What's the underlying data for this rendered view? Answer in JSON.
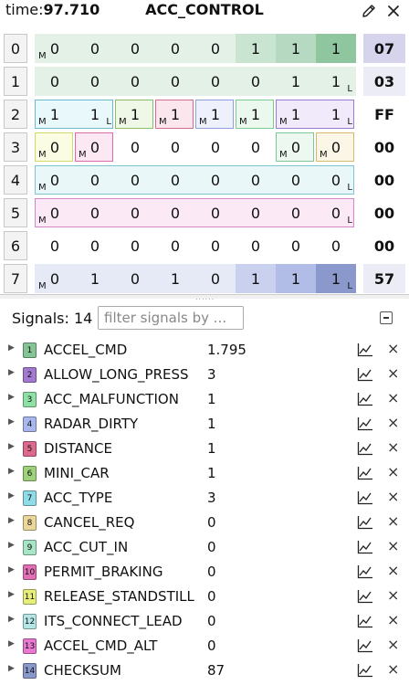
{
  "header": {
    "time_label": "time:",
    "time_value": "97.710",
    "title": "ACC_CONTROL"
  },
  "bytes": [
    {
      "index": "0",
      "bits": [
        "0",
        "0",
        "0",
        "0",
        "0",
        "1",
        "1",
        "1"
      ],
      "hex": "07"
    },
    {
      "index": "1",
      "bits": [
        "0",
        "0",
        "0",
        "0",
        "0",
        "0",
        "1",
        "1"
      ],
      "hex": "03"
    },
    {
      "index": "2",
      "bits": [
        "1",
        "1",
        "1",
        "1",
        "1",
        "1",
        "1",
        "1"
      ],
      "hex": "FF"
    },
    {
      "index": "3",
      "bits": [
        "0",
        "0",
        "0",
        "0",
        "0",
        "0",
        "0",
        "0"
      ],
      "hex": "00"
    },
    {
      "index": "4",
      "bits": [
        "0",
        "0",
        "0",
        "0",
        "0",
        "0",
        "0",
        "0"
      ],
      "hex": "00"
    },
    {
      "index": "5",
      "bits": [
        "0",
        "0",
        "0",
        "0",
        "0",
        "0",
        "0",
        "0"
      ],
      "hex": "00"
    },
    {
      "index": "6",
      "bits": [
        "0",
        "0",
        "0",
        "0",
        "0",
        "0",
        "0",
        "0"
      ],
      "hex": "00"
    },
    {
      "index": "7",
      "bits": [
        "0",
        "1",
        "0",
        "1",
        "0",
        "1",
        "1",
        "1"
      ],
      "hex": "57"
    }
  ],
  "marker_msb": "M",
  "marker_lsb": "L",
  "signals_header": {
    "label": "Signals: 14",
    "filter_placeholder": "filter signals by ..."
  },
  "signals": [
    {
      "num": "1",
      "name": "ACCEL_CMD",
      "value": "1.795",
      "color": "#86c496"
    },
    {
      "num": "2",
      "name": "ALLOW_LONG_PRESS",
      "value": "3",
      "color": "#a27ad0"
    },
    {
      "num": "3",
      "name": "ACC_MALFUNCTION",
      "value": "1",
      "color": "#8fe0a4"
    },
    {
      "num": "4",
      "name": "RADAR_DIRTY",
      "value": "1",
      "color": "#a8b8ee"
    },
    {
      "num": "5",
      "name": "DISTANCE",
      "value": "1",
      "color": "#db6a8c"
    },
    {
      "num": "6",
      "name": "MINI_CAR",
      "value": "1",
      "color": "#9ed27a"
    },
    {
      "num": "7",
      "name": "ACC_TYPE",
      "value": "3",
      "color": "#8fdce8"
    },
    {
      "num": "8",
      "name": "CANCEL_REQ",
      "value": "0",
      "color": "#ecd79a"
    },
    {
      "num": "9",
      "name": "ACC_CUT_IN",
      "value": "0",
      "color": "#a8e4c6"
    },
    {
      "num": "10",
      "name": "PERMIT_BRAKING",
      "value": "0",
      "color": "#e070b4"
    },
    {
      "num": "11",
      "name": "RELEASE_STANDSTILL",
      "value": "0",
      "color": "#e6ee7c"
    },
    {
      "num": "12",
      "name": "ITS_CONNECT_LEAD",
      "value": "0",
      "color": "#b4e6e6"
    },
    {
      "num": "13",
      "name": "ACCEL_CMD_ALT",
      "value": "0",
      "color": "#e878d0"
    },
    {
      "num": "14",
      "name": "CHECKSUM",
      "value": "87",
      "color": "#8a98cc"
    }
  ]
}
